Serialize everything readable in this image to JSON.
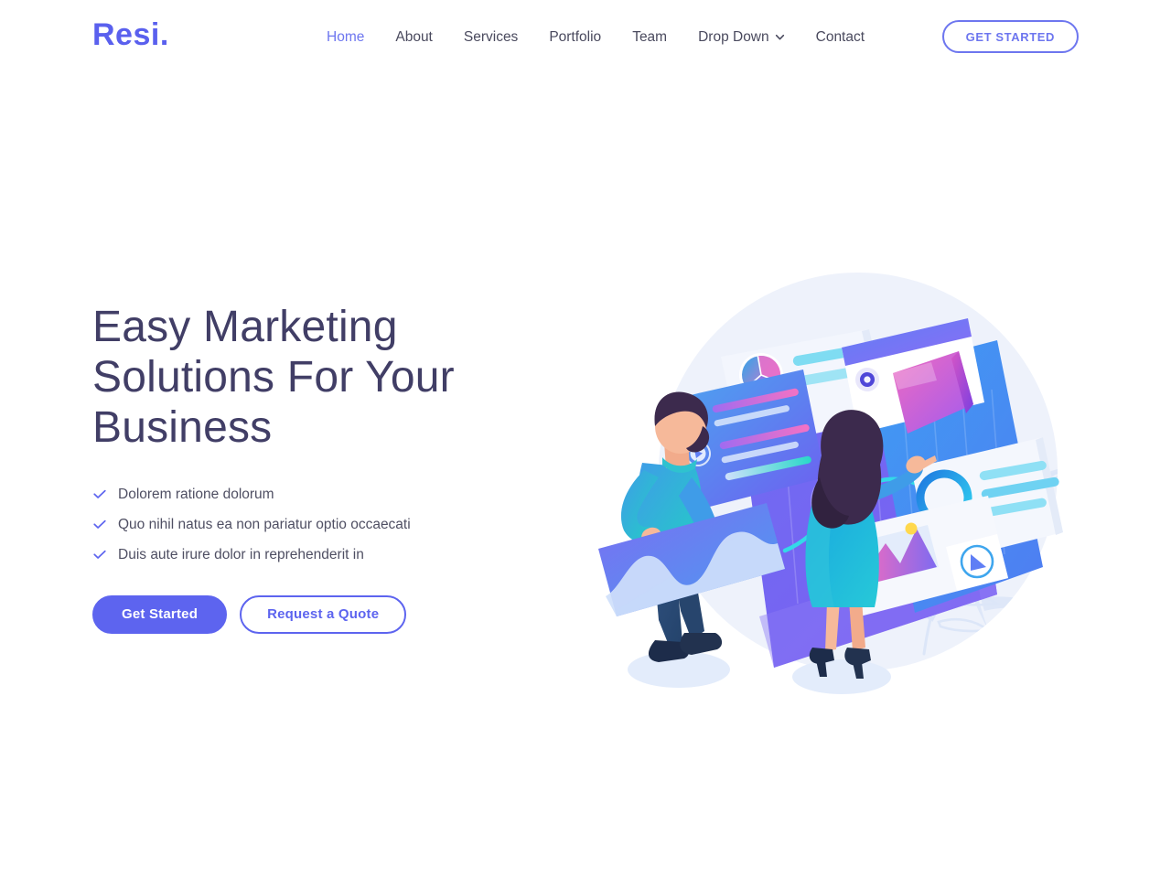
{
  "header": {
    "brand": "Resi.",
    "nav": [
      {
        "label": "Home",
        "active": true,
        "dropdown": false
      },
      {
        "label": "About",
        "active": false,
        "dropdown": false
      },
      {
        "label": "Services",
        "active": false,
        "dropdown": false
      },
      {
        "label": "Portfolio",
        "active": false,
        "dropdown": false
      },
      {
        "label": "Team",
        "active": false,
        "dropdown": false
      },
      {
        "label": "Drop Down",
        "active": false,
        "dropdown": true
      },
      {
        "label": "Contact",
        "active": false,
        "dropdown": false
      }
    ],
    "cta_label": "GET STARTED"
  },
  "hero": {
    "title": "Easy Marketing Solutions For Your Business",
    "features": [
      "Dolorem ratione dolorum",
      "Quo nihil natus ea non pariatur optio occaecati",
      "Duis aute irure dolor in reprehenderit in"
    ],
    "primary_button": "Get Started",
    "secondary_button": "Request a Quote",
    "illustration_alt": "Two people arranging isometric dashboard analytics cards"
  },
  "colors": {
    "page_background": "#ffffff",
    "brand_purple": "#5a60ee",
    "accent_indigo": "#6d76ef",
    "nav_text": "#4a4a5e",
    "heading_navy": "#413e66",
    "body_text": "#4f4f63",
    "check_blue": "#5d64ef",
    "button_primary_bg": "#5d64ef",
    "illustration_backdrop": "#eef2fb",
    "illustration_cyan": "#2ec5e8",
    "illustration_pink": "#e862c8",
    "illustration_violet": "#6f5cf0",
    "illustration_blue": "#3d8bf2",
    "skin_tone": "#f6b99a",
    "hair_dark": "#3c2a4d",
    "denim": "#2d4f7c"
  },
  "icons": {
    "chevron_down": "chevron-down-icon",
    "check": "check-icon"
  }
}
